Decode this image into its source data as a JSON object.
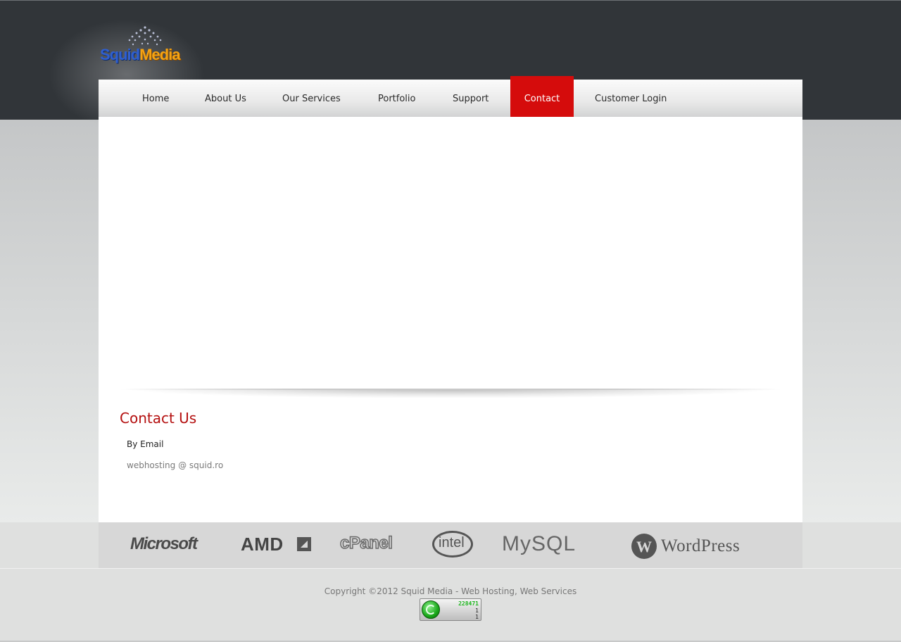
{
  "logo": {
    "part1": "Squid",
    "part2": "Media"
  },
  "nav": {
    "items": [
      {
        "label": "Home"
      },
      {
        "label": "About Us"
      },
      {
        "label": "Our Services"
      },
      {
        "label": "Portfolio"
      },
      {
        "label": "Support"
      },
      {
        "label": "Contact",
        "active": true
      },
      {
        "label": "Customer Login"
      }
    ]
  },
  "contact": {
    "title": "Contact Us",
    "by_email_label": "By Email",
    "email": "webhosting @ squid.ro"
  },
  "partners": {
    "microsoft": "Microsoft",
    "amd": "AMD",
    "cpanel": "cPanel",
    "intel": "intel",
    "mysql": "MySQL",
    "wordpress": "WordPress"
  },
  "footer": {
    "copyright": "Copyright ©2012 Squid Media - Web Hosting, Web Services",
    "counter": {
      "total": "228471",
      "line2": "1",
      "line3": "1"
    }
  },
  "colors": {
    "header_bg": "#313539",
    "accent_red": "#d50c0c",
    "title_red": "#b40f0f"
  }
}
